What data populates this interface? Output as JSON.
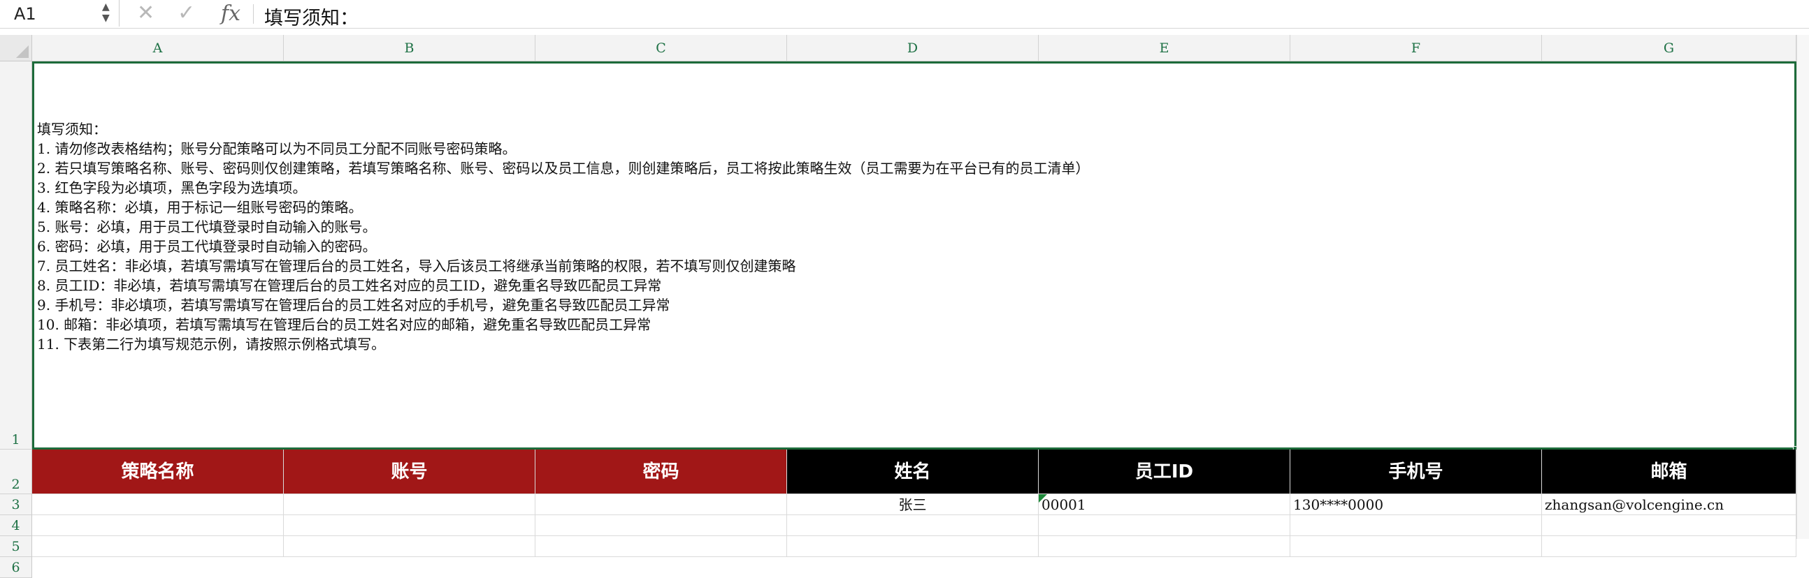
{
  "formula_bar": {
    "cell_ref": "A1",
    "formula": "填写须知："
  },
  "columns": [
    "A",
    "B",
    "C",
    "D",
    "E",
    "F",
    "G"
  ],
  "rows": [
    "1",
    "2",
    "3",
    "4",
    "5",
    "6"
  ],
  "notes": [
    "填写须知：",
    "1. 请勿修改表格结构；账号分配策略可以为不同员工分配不同账号密码策略。",
    "2. 若只填写策略名称、账号、密码则仅创建策略，若填写策略名称、账号、密码以及员工信息，则创建策略后，员工将按此策略生效（员工需要为在平台已有的员工清单）",
    "3. 红色字段为必填项，黑色字段为选填项。",
    "4. 策略名称：必填，用于标记一组账号密码的策略。",
    "5. 账号：必填，用于员工代填登录时自动输入的账号。",
    "6. 密码：必填，用于员工代填登录时自动输入的密码。",
    "7. 员工姓名：非必填，若填写需填写在管理后台的员工姓名，导入后该员工将继承当前策略的权限，若不填写则仅创建策略",
    "8. 员工ID：非必填，若填写需填写在管理后台的员工姓名对应的员工ID，避免重名导致匹配员工异常",
    "9. 手机号：非必填项，若填写需填写在管理后台的员工姓名对应的手机号，避免重名导致匹配员工异常",
    "10.  邮箱：非必填项，若填写需填写在管理后台的员工姓名对应的邮箱，避免重名导致匹配员工异常",
    "11. 下表第二行为填写规范示例，请按照示例格式填写。"
  ],
  "headers": {
    "policy_name": "策略名称",
    "account": "账号",
    "password": "密码",
    "name": "姓名",
    "employee_id": "员工ID",
    "phone": "手机号",
    "email": "邮箱"
  },
  "example_row": {
    "policy_name": "",
    "account": "",
    "password": "",
    "name": "张三",
    "employee_id": "00001",
    "phone": "130****0000",
    "email": "zhangsan@volcengine.cn"
  },
  "colors": {
    "required_header": "#a11717",
    "optional_header": "#000000",
    "selection": "#1d6b3a",
    "header_text": "#1e7145"
  }
}
